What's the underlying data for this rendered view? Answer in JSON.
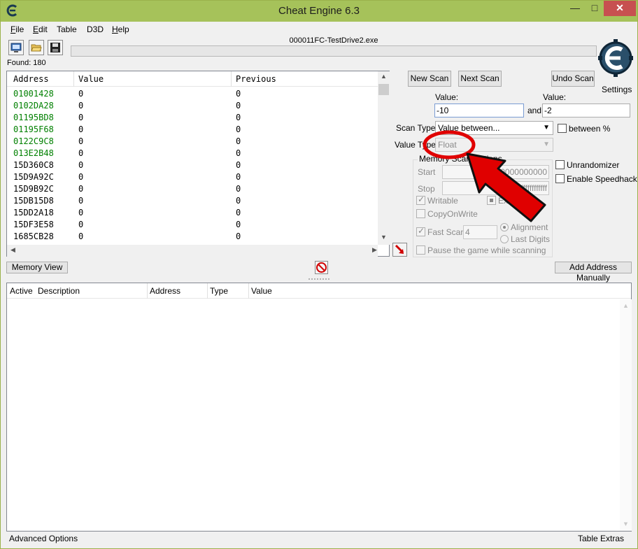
{
  "window": {
    "title": "Cheat Engine 6.3",
    "minimize": "—",
    "maximize": "□",
    "close": "✕"
  },
  "menu": [
    {
      "label": "File",
      "accel": "F",
      "rest": "ile"
    },
    {
      "label": "Edit",
      "accel": "E",
      "rest": "dit"
    },
    {
      "label": "Table",
      "accel": "",
      "rest": "Table"
    },
    {
      "label": "D3D",
      "accel": "",
      "rest": "D3D"
    },
    {
      "label": "Help",
      "accel": "H",
      "rest": "elp"
    }
  ],
  "process_name": "000011FC-TestDrive2.exe",
  "found": "Found: 180",
  "results": {
    "columns": [
      "Address",
      "Value",
      "Previous"
    ],
    "rows": [
      {
        "address": "01001428",
        "value": "0",
        "previous": "0",
        "green": true
      },
      {
        "address": "0102DA28",
        "value": "0",
        "previous": "0",
        "green": true
      },
      {
        "address": "01195BD8",
        "value": "0",
        "previous": "0",
        "green": true
      },
      {
        "address": "01195F68",
        "value": "0",
        "previous": "0",
        "green": true
      },
      {
        "address": "0122C9C8",
        "value": "0",
        "previous": "0",
        "green": true
      },
      {
        "address": "013E2B48",
        "value": "0",
        "previous": "0",
        "green": true
      },
      {
        "address": "15D360C8",
        "value": "0",
        "previous": "0",
        "green": false
      },
      {
        "address": "15D9A92C",
        "value": "0",
        "previous": "0",
        "green": false
      },
      {
        "address": "15D9B92C",
        "value": "0",
        "previous": "0",
        "green": false
      },
      {
        "address": "15DB15D8",
        "value": "0",
        "previous": "0",
        "green": false
      },
      {
        "address": "15DD2A18",
        "value": "0",
        "previous": "0",
        "green": false
      },
      {
        "address": "15DF3E58",
        "value": "0",
        "previous": "0",
        "green": false
      },
      {
        "address": "1685CB28",
        "value": "0",
        "previous": "0",
        "green": false
      }
    ]
  },
  "scan": {
    "new_scan": "New Scan",
    "next_scan": "Next Scan",
    "undo_scan": "Undo Scan",
    "settings": "Settings",
    "value_label_1": "Value:",
    "value_label_2": "Value:",
    "value_1": "-10",
    "and_label": "and",
    "value_2": "-2",
    "scan_type_label": "Scan Type",
    "scan_type": "Value between...",
    "between_pct": "between %",
    "value_type_label": "Value Type",
    "value_type": "Float",
    "memory_options_label": "Memory Scan Options",
    "start_label": "Start",
    "start_value": "0000000000000000",
    "stop_label": "Stop",
    "stop_value": "7fffffffffffffff",
    "writable": "Writable",
    "executable": "Executable",
    "copy_on_write": "CopyOnWrite",
    "fast_scan": "Fast Scan",
    "fast_scan_value": "4",
    "alignment": "Alignment",
    "last_digits": "Last Digits",
    "pause_game": "Pause the game while scanning",
    "unrandomizer": "Unrandomizer",
    "enable_speedhack": "Enable Speedhack"
  },
  "memory_view": "Memory View",
  "add_address": "Add Address Manually",
  "address_table": {
    "columns": [
      "Active",
      "Description",
      "Address",
      "Type",
      "Value"
    ]
  },
  "status": {
    "advanced_options": "Advanced Options",
    "table_extras": "Table Extras"
  },
  "colors": {
    "titlebar": "#a6c25a",
    "green_address": "#008000",
    "annotation_red": "#e00000"
  }
}
